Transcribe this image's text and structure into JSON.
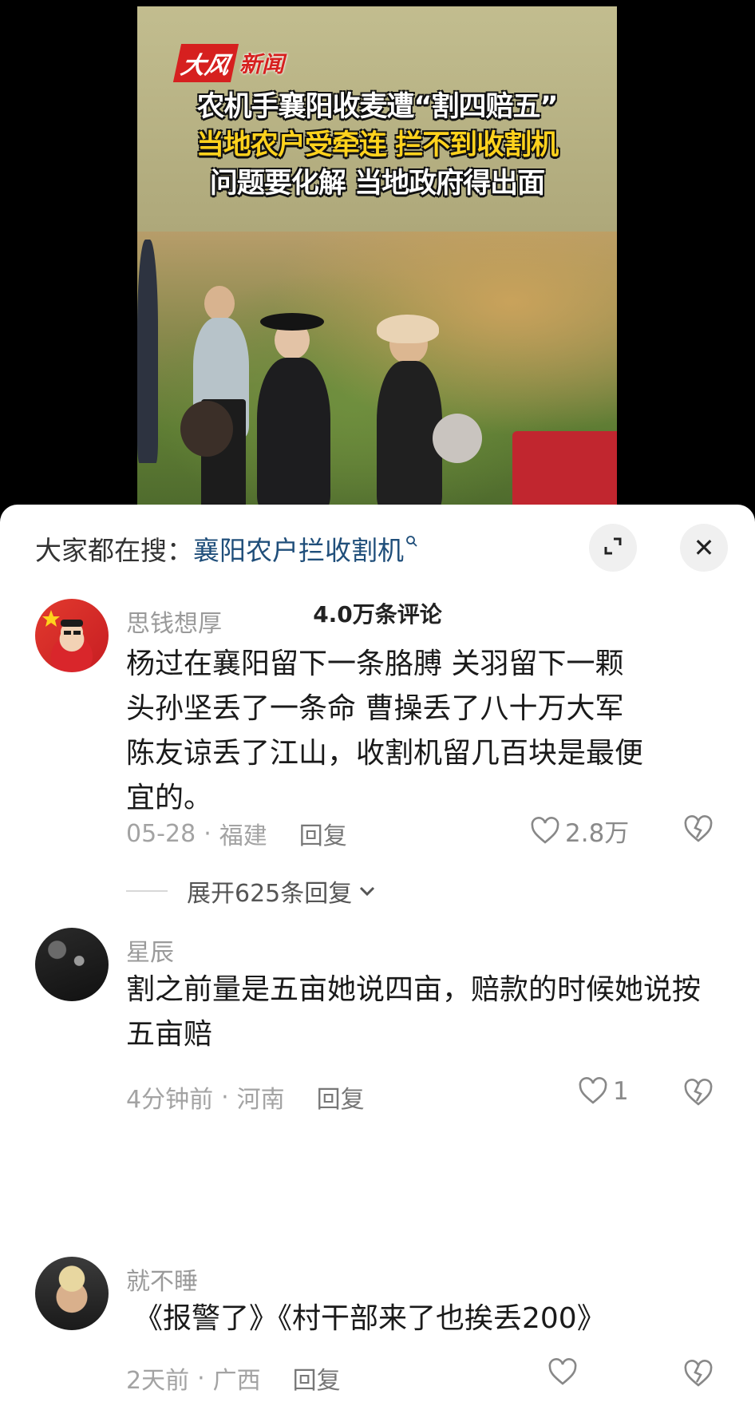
{
  "video": {
    "logo_mark": "大风",
    "logo_text": "新闻",
    "headline_1": "农机手襄阳收麦遭“割四赔五”",
    "headline_2": "当地农户受牵连 拦不到收割机",
    "headline_3": "问题要化解 当地政府得出面",
    "colors": {
      "headline_white": "#ffffff",
      "headline_yellow": "#ffd21d",
      "logo_red": "#d6201f"
    }
  },
  "search_bar": {
    "prefix": "大家都在搜：",
    "keyword": "襄阳农户拦收割机",
    "search_icon": "search-icon"
  },
  "buttons": {
    "expand_icon": "expand-icon",
    "close_icon": "close-icon",
    "close_glyph": "✕"
  },
  "comment_count": "4.0万条评论",
  "comments": [
    {
      "user": "思钱想厚",
      "text": "杨过在襄阳留下一条胳膊 关羽留下一颗头孙坚丢了一条命 曹操丢了八十万大军 陈友谅丢了江山，收割机留几百块是最便宜的。",
      "time": "05-28",
      "location": "福建",
      "reply": "回复",
      "likes": "2.8万",
      "expand_replies": "展开625条回复"
    },
    {
      "user": "星辰",
      "text": "割之前量是五亩她说四亩，赔款的时候她说按五亩赔",
      "time": "4分钟前",
      "location": "河南",
      "reply": "回复",
      "likes": "1"
    },
    {
      "user": "就不睡",
      "text": "《报警了》《村干部来了也挨丢200》",
      "time": "2天前",
      "location": "广西",
      "reply": "回复",
      "likes": ""
    }
  ],
  "separator": "·"
}
